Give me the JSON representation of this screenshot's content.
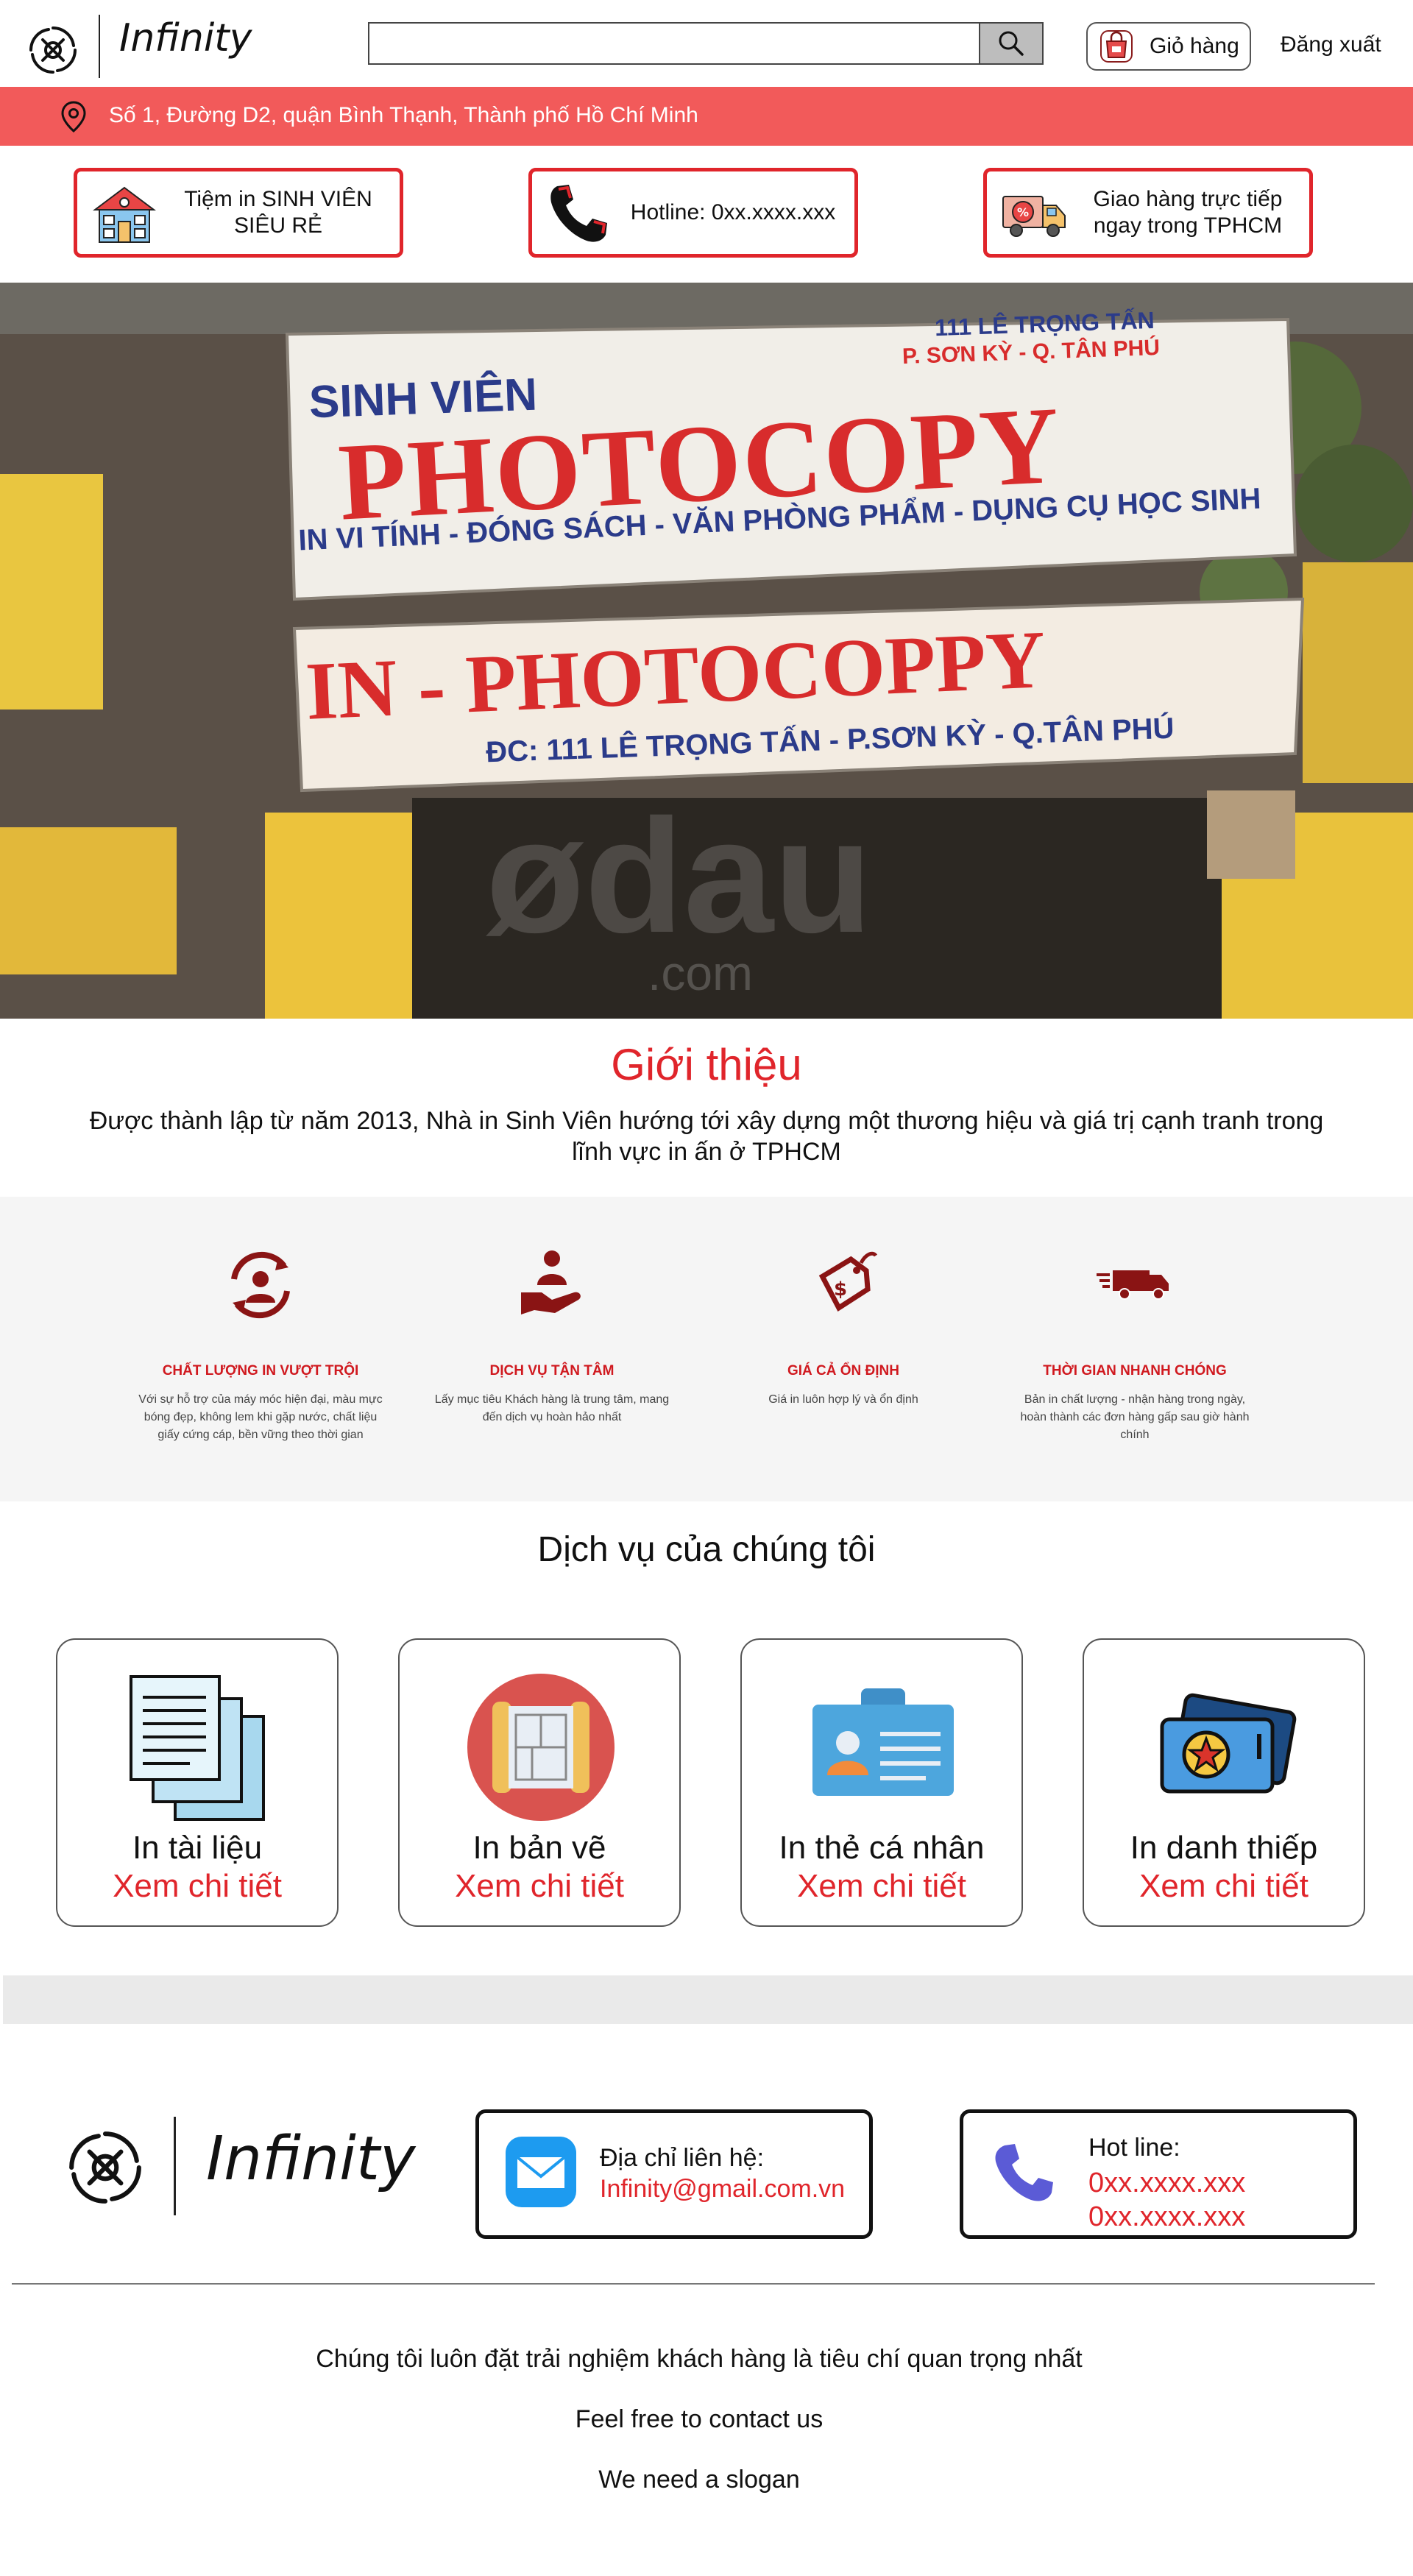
{
  "header": {
    "brand": "Infinity",
    "search": {
      "placeholder": "",
      "value": ""
    },
    "cart_label": "Giỏ hàng",
    "logout_label": "Đăng xuất"
  },
  "address": "Số 1, Đường D2, quận Bình Thạnh, Thành phố Hồ Chí Minh",
  "features": [
    {
      "text": "Tiệm in SINH VIÊN SIÊU RẺ",
      "icon": "shop-icon"
    },
    {
      "text": "Hotline: 0xx.xxxx.xxx",
      "icon": "phone-icon"
    },
    {
      "text": "Giao hàng trực tiếp ngay trong TPHCM",
      "icon": "delivery-truck-icon"
    }
  ],
  "hero": {
    "sign_top": "SINH VIÊN",
    "sign_main": "PHOTOCOPY",
    "sign_sub": "IN VI TÍNH - ĐÓNG SÁCH - VĂN PHÒNG PHẨM - DỤNG CỤ HỌC SINH",
    "sign_addr_top": "111 LÊ TRỌNG TẤN",
    "sign_addr_top2": "P. SƠN KỲ - Q. TÂN PHÚ",
    "sign2_main": "IN - PHOTOCOPPY",
    "sign2_addr": "ĐC: 111 LÊ TRỌNG TẤN - P.SƠN KỲ - Q.TÂN PHÚ",
    "watermark": "ødau",
    "watermark_sub": ".com"
  },
  "intro": {
    "title": "Giới thiệu",
    "text": "Được thành lập từ năm 2013, Nhà in Sinh Viên hướng tới xây dựng một thương hiệu và giá trị cạnh tranh trong lĩnh vực in ấn ở TPHCM"
  },
  "values": [
    {
      "title": "CHẤT LƯỢNG IN VƯỢT TRỘI",
      "text": "Với sự hỗ trợ của máy móc hiện đại, màu mực bóng đẹp, không lem khi gặp nước, chất liệu giấy cứng cáp, bền vững theo thời gian",
      "icon": "quality-cycle-icon"
    },
    {
      "title": "DỊCH VỤ TẬN TÂM",
      "text": "Lấy mục tiêu Khách hàng là trung tâm, mang đến dịch vụ hoàn hảo nhất",
      "icon": "customer-care-icon"
    },
    {
      "title": "GIÁ CẢ ỔN ĐỊNH",
      "text": "Giá in luôn hợp lý và ổn định",
      "icon": "price-tag-icon"
    },
    {
      "title": "THỜI GIAN NHANH CHÓNG",
      "text": "Bản in chất lượng - nhận hàng trong ngày, hoàn thành các đơn hàng gấp sau giờ hành chính",
      "icon": "fast-truck-icon"
    }
  ],
  "services": {
    "title": "Dịch vụ của chúng tôi",
    "items": [
      {
        "name": "In tài liệu",
        "link": "Xem chi tiết",
        "icon": "documents-icon"
      },
      {
        "name": "In bản vẽ",
        "link": "Xem chi tiết",
        "icon": "blueprint-icon"
      },
      {
        "name": "In thẻ cá nhân",
        "link": "Xem chi tiết",
        "icon": "id-card-icon"
      },
      {
        "name": "In danh thiếp",
        "link": "Xem chi tiết",
        "icon": "business-card-icon"
      }
    ]
  },
  "footer": {
    "brand": "Infinity",
    "contact_label": "Địa chỉ liên hệ:",
    "contact_email": "Infinity@gmail.com.vn",
    "hotline_label": "Hot line:",
    "hotline_1": "0xx.xxxx.xxx",
    "hotline_2": "0xx.xxxx.xxx",
    "lines": [
      "Chúng tôi luôn đặt trải nghiệm khách hàng là tiêu chí quan trọng nhất",
      "Feel free to contact us",
      "We need a slogan"
    ]
  },
  "colors": {
    "accent_red": "#e0252b",
    "address_bar": "#f25a5a",
    "value_title": "#d0191f"
  }
}
